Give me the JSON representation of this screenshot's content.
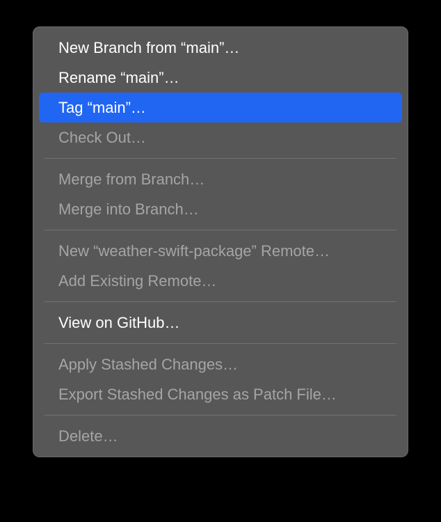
{
  "menu": {
    "items": [
      {
        "label": "New Branch from “main”…",
        "state": "enabled"
      },
      {
        "label": "Rename “main”…",
        "state": "enabled"
      },
      {
        "label": "Tag “main”…",
        "state": "highlighted"
      },
      {
        "label": "Check Out…",
        "state": "disabled"
      },
      {
        "type": "separator"
      },
      {
        "label": "Merge from Branch…",
        "state": "disabled"
      },
      {
        "label": "Merge into Branch…",
        "state": "disabled"
      },
      {
        "type": "separator"
      },
      {
        "label": "New “weather-swift-package” Remote…",
        "state": "disabled"
      },
      {
        "label": "Add Existing Remote…",
        "state": "disabled"
      },
      {
        "type": "separator"
      },
      {
        "label": "View on GitHub…",
        "state": "enabled"
      },
      {
        "type": "separator"
      },
      {
        "label": "Apply Stashed Changes…",
        "state": "disabled"
      },
      {
        "label": "Export Stashed Changes as Patch File…",
        "state": "disabled"
      },
      {
        "type": "separator"
      },
      {
        "label": "Delete…",
        "state": "disabled"
      }
    ]
  },
  "colors": {
    "background": "#000000",
    "menu_bg": "#575757",
    "highlight": "#2166f3",
    "text_enabled": "#ffffff",
    "text_disabled": "#a5a5a5",
    "separator": "#737373"
  }
}
